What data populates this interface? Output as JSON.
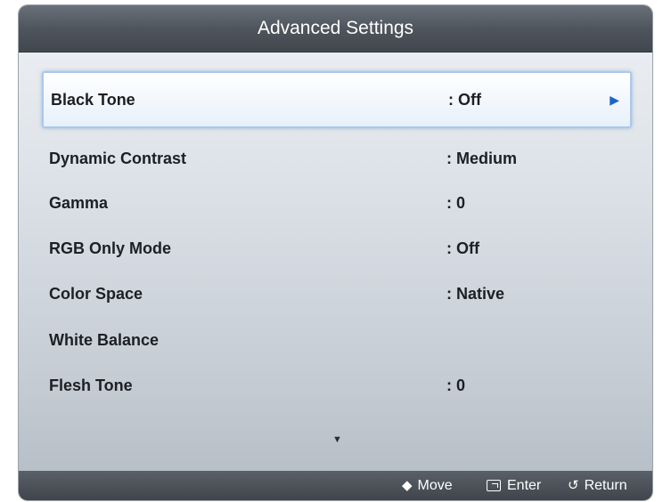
{
  "header": {
    "title": "Advanced Settings"
  },
  "items": [
    {
      "label": "Black Tone",
      "value": ": Off"
    },
    {
      "label": "Dynamic Contrast",
      "value": ": Medium"
    },
    {
      "label": "Gamma",
      "value": ": 0"
    },
    {
      "label": "RGB Only Mode",
      "value": ": Off"
    },
    {
      "label": "Color Space",
      "value": ": Native"
    },
    {
      "label": "White Balance",
      "value": ""
    },
    {
      "label": "Flesh Tone",
      "value": ": 0"
    }
  ],
  "icons": {
    "submenu_arrow": "▶",
    "scroll_down": "▼",
    "move": "◆",
    "return": "↺"
  },
  "footer": {
    "move_label": "Move",
    "enter_label": "Enter",
    "return_label": "Return"
  }
}
